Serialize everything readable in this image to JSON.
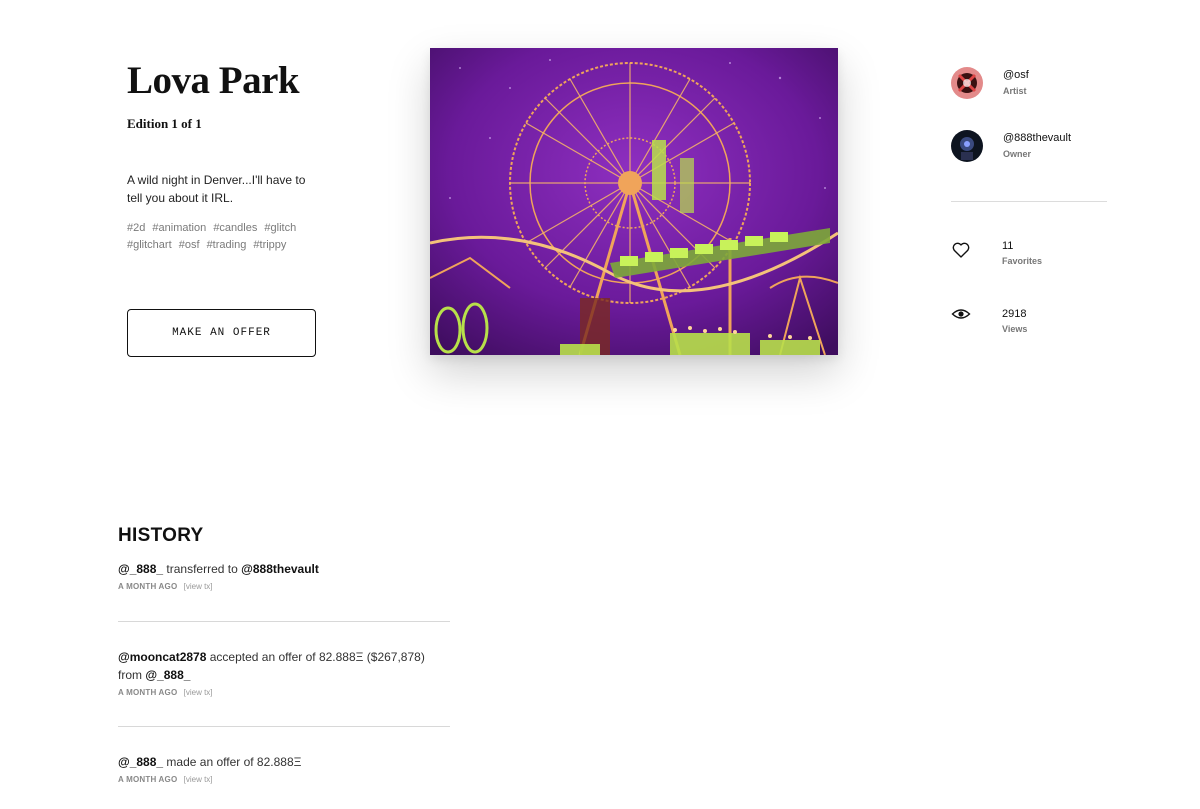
{
  "artwork": {
    "title": "Lova Park",
    "edition": "Edition 1 of 1",
    "description": "A wild night in Denver...I'll have to tell you about it IRL.",
    "tags": [
      "#2d",
      "#animation",
      "#candles",
      "#glitch",
      "#glitchart",
      "#osf",
      "#trading",
      "#trippy"
    ],
    "offer_button": "MAKE AN OFFER",
    "image_subject": "ferris-wheel-night-carnival"
  },
  "people": {
    "artist": {
      "handle": "@osf",
      "role": "Artist"
    },
    "owner": {
      "handle": "@888thevault",
      "role": "Owner"
    }
  },
  "stats": {
    "favorites": {
      "count": "11",
      "label": "Favorites",
      "icon": "heart-icon"
    },
    "views": {
      "count": "2918",
      "label": "Views",
      "icon": "eye-icon"
    }
  },
  "history": {
    "title": "HISTORY",
    "items": [
      {
        "actor": "@_888_",
        "action": "transferred to",
        "target": "@888thevault",
        "time": "A MONTH AGO",
        "link": "[view tx]"
      },
      {
        "actor": "@mooncat2878",
        "action": "accepted an offer of 82.888Ξ ($267,878) from",
        "target": "@_888_",
        "time": "A MONTH AGO",
        "link": "[view tx]"
      },
      {
        "actor": "@_888_",
        "action": "made an offer of 82.888Ξ",
        "target": "",
        "time": "A MONTH AGO",
        "link": "[view tx]"
      }
    ]
  },
  "colors": {
    "text": "#111111",
    "muted": "#777777",
    "sky_purple": "#6a1a9a",
    "lights_orange": "#f0a45a",
    "lights_green": "#b8e04a"
  }
}
